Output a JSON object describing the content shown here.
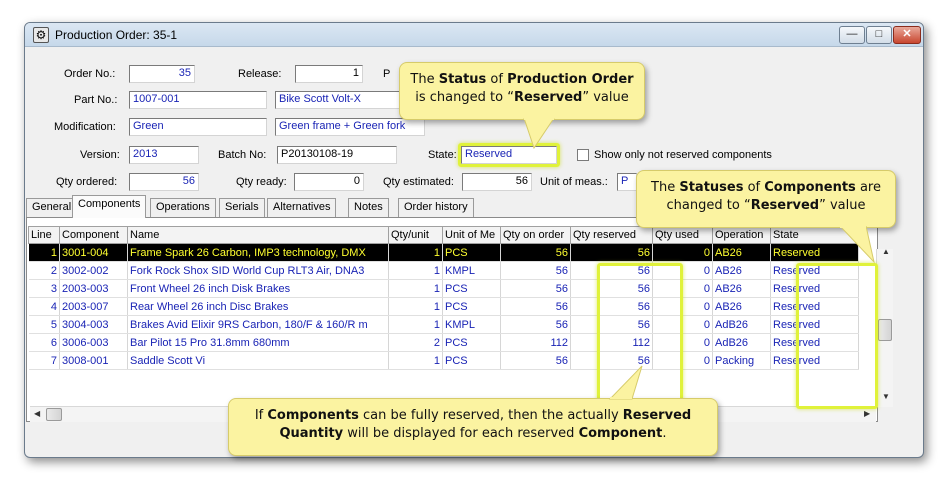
{
  "window": {
    "title": "Production Order: 35-1"
  },
  "header": {
    "order_no": {
      "label": "Order No.:",
      "value": "35"
    },
    "release": {
      "label": "Release:",
      "value": "1"
    },
    "clipped_label": "P",
    "part_no": {
      "label": "Part No.:",
      "value": "1007-001",
      "desc": "Bike Scott Volt-X"
    },
    "modification": {
      "label": "Modification:",
      "value": "Green",
      "desc": "Green frame + Green fork"
    },
    "version": {
      "label": "Version:",
      "value": "2013"
    },
    "batch_no": {
      "label": "Batch No:",
      "value": "P20130108-19"
    },
    "state": {
      "label": "State:",
      "value": "Reserved"
    },
    "show_not_reserved": {
      "label": "Show only not reserved components",
      "checked": false
    },
    "qty_ordered": {
      "label": "Qty ordered:",
      "value": "56"
    },
    "qty_ready": {
      "label": "Qty ready:",
      "value": "0"
    },
    "qty_estimated": {
      "label": "Qty estimated:",
      "value": "56"
    },
    "unit_of_meas": {
      "label": "Unit of meas.:",
      "value": "P"
    }
  },
  "tabs": [
    {
      "label": "General",
      "active": false
    },
    {
      "label": "Components",
      "active": true
    },
    {
      "label": "Operations",
      "active": false
    },
    {
      "label": "Serials",
      "active": false
    },
    {
      "label": "Alternatives",
      "active": false
    },
    {
      "label": "Notes",
      "active": false
    },
    {
      "label": "Order history",
      "active": false
    }
  ],
  "grid": {
    "columns": [
      "Line",
      "Component",
      "Name",
      "Qty/unit",
      "Unit of Me",
      "Qty on order",
      "Qty reserved",
      "Qty used",
      "Operation",
      "State"
    ],
    "rows": [
      [
        "1",
        "3001-004",
        "Frame Spark 26 Carbon, IMP3 technology, DMX",
        "1",
        "PCS",
        "56",
        "56",
        "0",
        "AB26",
        "Reserved"
      ],
      [
        "2",
        "3002-002",
        "Fork Rock Shox SID World Cup RLT3 Air, DNA3",
        "1",
        "KMPL",
        "56",
        "56",
        "0",
        "AB26",
        "Reserved"
      ],
      [
        "3",
        "2003-003",
        "Front Wheel 26 inch Disk Brakes",
        "1",
        "PCS",
        "56",
        "56",
        "0",
        "AB26",
        "Reserved"
      ],
      [
        "4",
        "2003-007",
        "Rear Wheel 26 inch Disc Brakes",
        "1",
        "PCS",
        "56",
        "56",
        "0",
        "AB26",
        "Reserved"
      ],
      [
        "5",
        "3004-003",
        "Brakes Avid Elixir 9RS Carbon, 180/F & 160/R m",
        "1",
        "KMPL",
        "56",
        "56",
        "0",
        "AdB26",
        "Reserved"
      ],
      [
        "6",
        "3006-003",
        "Bar Pilot 15 Pro 31.8mm 680mm",
        "2",
        "PCS",
        "112",
        "112",
        "0",
        "AdB26",
        "Reserved"
      ],
      [
        "7",
        "3008-001",
        "Saddle Scott Vi",
        "1",
        "PCS",
        "56",
        "56",
        "0",
        "Packing",
        "Reserved"
      ]
    ],
    "selected_row": 0
  },
  "callouts": {
    "status": [
      "The ",
      "Status",
      " of ",
      "Production Order",
      " is changed to “",
      "Reserved",
      "” value"
    ],
    "statuses": [
      "The ",
      "Statuses",
      " of ",
      "Components",
      " are changed to “",
      "Reserved",
      "” value"
    ],
    "reserved_qty": [
      "If ",
      "Components",
      " can be fully reserved, then the actually ",
      "Reserved Quantity",
      " will be displayed for each reserved ",
      "Component",
      "."
    ]
  },
  "colors": {
    "highlight": "#e0f23a",
    "callout_bg": "#fbf3a1",
    "grid_text": "#1a24b5"
  }
}
